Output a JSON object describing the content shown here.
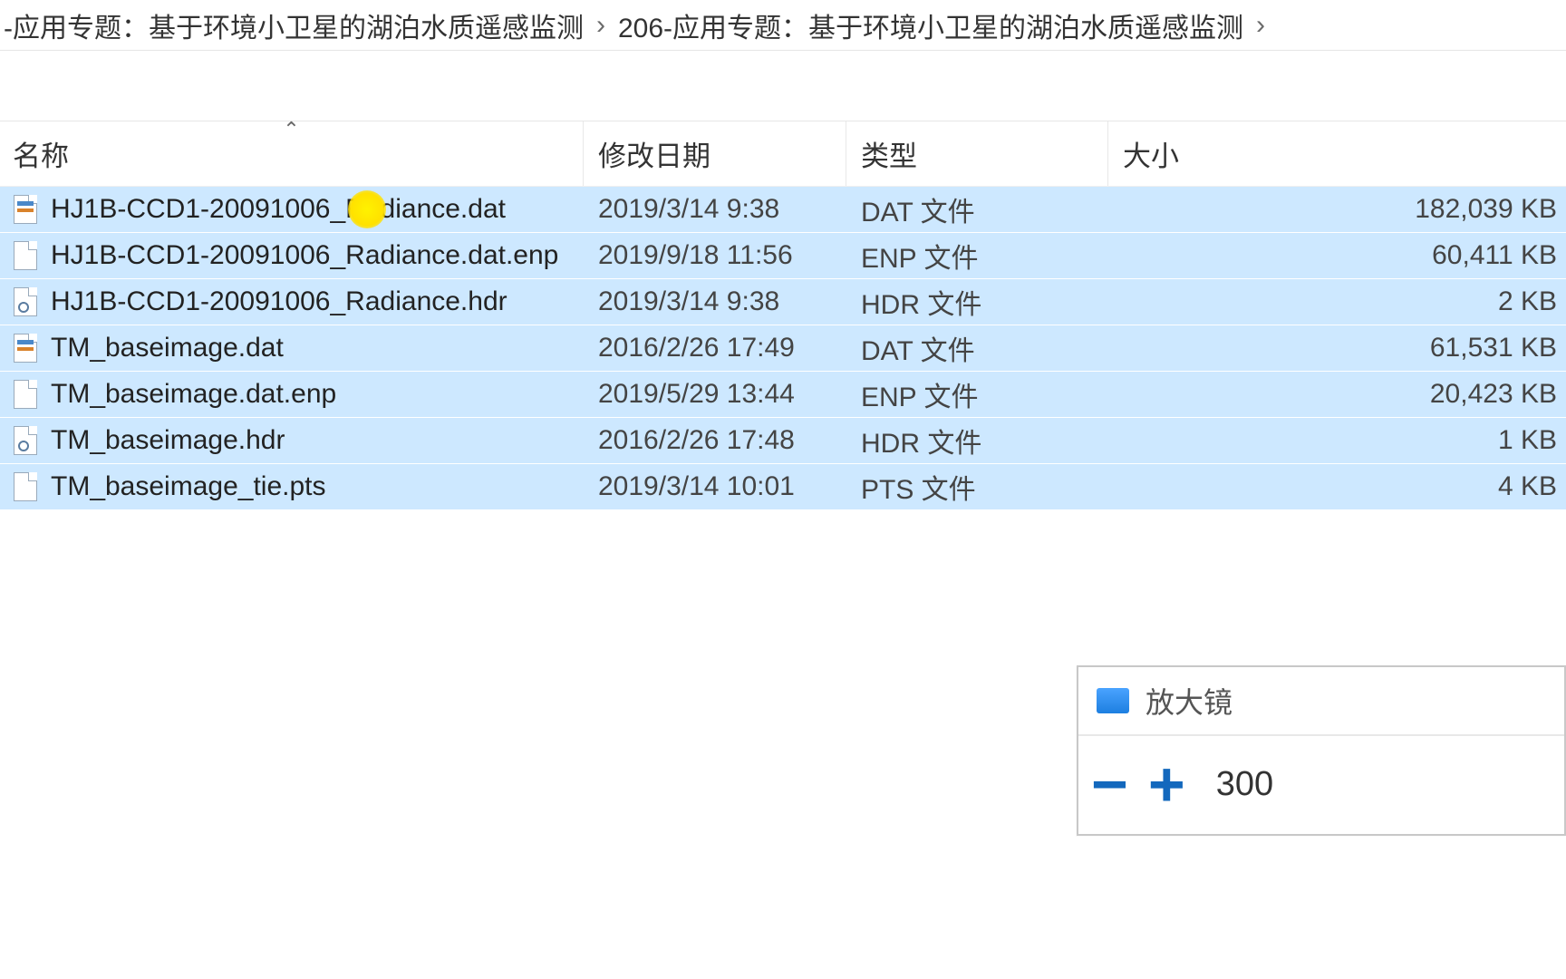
{
  "breadcrumb": {
    "item1": "-应用专题：基于环境小卫星的湖泊水质遥感监测",
    "sep": "›",
    "item2": "206-应用专题：基于环境小卫星的湖泊水质遥感监测",
    "trailing_sep": "›"
  },
  "columns": {
    "name": "名称",
    "date": "修改日期",
    "type": "类型",
    "size": "大小"
  },
  "files": [
    {
      "name": "HJ1B-CCD1-20091006_Radiance.dat",
      "date": "2019/3/14 9:38",
      "type": "DAT 文件",
      "size": "182,039 KB",
      "icon": "dat"
    },
    {
      "name": "HJ1B-CCD1-20091006_Radiance.dat.enp",
      "date": "2019/9/18 11:56",
      "type": "ENP 文件",
      "size": "60,411 KB",
      "icon": "blank"
    },
    {
      "name": "HJ1B-CCD1-20091006_Radiance.hdr",
      "date": "2019/3/14 9:38",
      "type": "HDR 文件",
      "size": "2 KB",
      "icon": "hdr"
    },
    {
      "name": "TM_baseimage.dat",
      "date": "2016/2/26 17:49",
      "type": "DAT 文件",
      "size": "61,531 KB",
      "icon": "dat"
    },
    {
      "name": "TM_baseimage.dat.enp",
      "date": "2019/5/29 13:44",
      "type": "ENP 文件",
      "size": "20,423 KB",
      "icon": "blank"
    },
    {
      "name": "TM_baseimage.hdr",
      "date": "2016/2/26 17:48",
      "type": "HDR 文件",
      "size": "1 KB",
      "icon": "hdr"
    },
    {
      "name": "TM_baseimage_tie.pts",
      "date": "2019/3/14 10:01",
      "type": "PTS 文件",
      "size": "4 KB",
      "icon": "blank"
    }
  ],
  "magnifier": {
    "title": "放大镜",
    "minus": "−",
    "plus": "+",
    "value": "300"
  }
}
